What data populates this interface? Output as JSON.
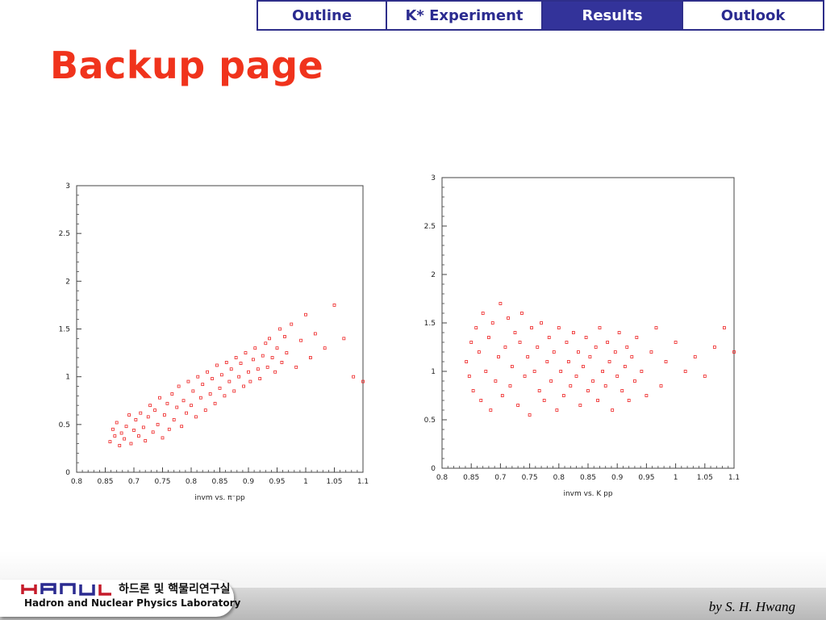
{
  "nav": {
    "tabs": [
      {
        "label": "Outline",
        "active": false
      },
      {
        "label": "K* Experiment",
        "active": false
      },
      {
        "label": "Results",
        "active": true
      },
      {
        "label": "Outlook",
        "active": false
      }
    ]
  },
  "title": "Backup page",
  "colors": {
    "title": "#f0331c",
    "nav_border": "#2e2e8a",
    "nav_active_bg": "#33339a",
    "nav_text": "#2b2b90",
    "marker": "#ee2222"
  },
  "chart_data": [
    {
      "type": "scatter",
      "title": "",
      "xlabel": "invm vs. π⁻pp",
      "ylabel": "",
      "xlim": [
        0.8,
        1.1
      ],
      "ylim": [
        0,
        3
      ],
      "xticks": [
        "0.8",
        "0.85",
        "0.7",
        "0.75",
        "0.8",
        "0.85",
        "0.9",
        "0.95",
        "1",
        "1.05",
        "1.1"
      ],
      "yticks": [
        "0",
        "0.5",
        "1",
        "1.5",
        "2",
        "2.5",
        "3"
      ],
      "grid": false,
      "marker": "open-square",
      "points": [
        [
          0.835,
          0.32
        ],
        [
          0.838,
          0.45
        ],
        [
          0.84,
          0.38
        ],
        [
          0.842,
          0.52
        ],
        [
          0.845,
          0.28
        ],
        [
          0.847,
          0.41
        ],
        [
          0.85,
          0.35
        ],
        [
          0.852,
          0.48
        ],
        [
          0.855,
          0.6
        ],
        [
          0.857,
          0.3
        ],
        [
          0.86,
          0.44
        ],
        [
          0.862,
          0.55
        ],
        [
          0.865,
          0.38
        ],
        [
          0.867,
          0.62
        ],
        [
          0.87,
          0.47
        ],
        [
          0.872,
          0.33
        ],
        [
          0.875,
          0.58
        ],
        [
          0.877,
          0.7
        ],
        [
          0.88,
          0.42
        ],
        [
          0.882,
          0.65
        ],
        [
          0.885,
          0.5
        ],
        [
          0.887,
          0.78
        ],
        [
          0.89,
          0.36
        ],
        [
          0.892,
          0.6
        ],
        [
          0.895,
          0.72
        ],
        [
          0.897,
          0.45
        ],
        [
          0.9,
          0.82
        ],
        [
          0.902,
          0.55
        ],
        [
          0.905,
          0.68
        ],
        [
          0.907,
          0.9
        ],
        [
          0.91,
          0.48
        ],
        [
          0.912,
          0.75
        ],
        [
          0.915,
          0.62
        ],
        [
          0.917,
          0.95
        ],
        [
          0.92,
          0.7
        ],
        [
          0.922,
          0.85
        ],
        [
          0.925,
          0.58
        ],
        [
          0.927,
          1.0
        ],
        [
          0.93,
          0.78
        ],
        [
          0.932,
          0.92
        ],
        [
          0.935,
          0.65
        ],
        [
          0.937,
          1.05
        ],
        [
          0.94,
          0.82
        ],
        [
          0.942,
          0.98
        ],
        [
          0.945,
          0.72
        ],
        [
          0.947,
          1.12
        ],
        [
          0.95,
          0.88
        ],
        [
          0.952,
          1.02
        ],
        [
          0.955,
          0.8
        ],
        [
          0.957,
          1.15
        ],
        [
          0.96,
          0.95
        ],
        [
          0.962,
          1.08
        ],
        [
          0.965,
          0.85
        ],
        [
          0.967,
          1.2
        ],
        [
          0.97,
          1.0
        ],
        [
          0.972,
          1.14
        ],
        [
          0.975,
          0.9
        ],
        [
          0.977,
          1.25
        ],
        [
          0.98,
          1.05
        ],
        [
          0.982,
          0.95
        ],
        [
          0.985,
          1.18
        ],
        [
          0.987,
          1.3
        ],
        [
          0.99,
          1.08
        ],
        [
          0.992,
          0.98
        ],
        [
          0.995,
          1.22
        ],
        [
          0.998,
          1.35
        ],
        [
          1.0,
          1.1
        ],
        [
          1.002,
          1.4
        ],
        [
          1.005,
          1.2
        ],
        [
          1.008,
          1.05
        ],
        [
          1.01,
          1.3
        ],
        [
          1.013,
          1.5
        ],
        [
          1.015,
          1.15
        ],
        [
          1.018,
          1.42
        ],
        [
          1.02,
          1.25
        ],
        [
          1.025,
          1.55
        ],
        [
          1.03,
          1.1
        ],
        [
          1.035,
          1.38
        ],
        [
          1.04,
          1.65
        ],
        [
          1.045,
          1.2
        ],
        [
          1.05,
          1.45
        ],
        [
          1.06,
          1.3
        ],
        [
          1.07,
          1.75
        ],
        [
          1.08,
          1.4
        ],
        [
          1.09,
          1.0
        ],
        [
          1.1,
          0.95
        ]
      ]
    },
    {
      "type": "scatter",
      "title": "",
      "xlabel": "invm vs. K pp",
      "ylabel": "",
      "xlim": [
        0.8,
        1.1
      ],
      "ylim": [
        0,
        3
      ],
      "xticks": [
        "0.8",
        "0.85",
        "0.7",
        "0.75",
        "0.8",
        "0.85",
        "0.9",
        "0.95",
        "1",
        "1.05",
        "1.1"
      ],
      "yticks": [
        "0",
        "0.5",
        "1",
        "1.5",
        "2",
        "2.5",
        "3"
      ],
      "grid": false,
      "marker": "open-square",
      "points": [
        [
          0.825,
          1.1
        ],
        [
          0.828,
          0.95
        ],
        [
          0.83,
          1.3
        ],
        [
          0.832,
          0.8
        ],
        [
          0.835,
          1.45
        ],
        [
          0.838,
          1.2
        ],
        [
          0.84,
          0.7
        ],
        [
          0.842,
          1.6
        ],
        [
          0.845,
          1.0
        ],
        [
          0.848,
          1.35
        ],
        [
          0.85,
          0.6
        ],
        [
          0.852,
          1.5
        ],
        [
          0.855,
          0.9
        ],
        [
          0.858,
          1.15
        ],
        [
          0.86,
          1.7
        ],
        [
          0.862,
          0.75
        ],
        [
          0.865,
          1.25
        ],
        [
          0.868,
          1.55
        ],
        [
          0.87,
          0.85
        ],
        [
          0.872,
          1.05
        ],
        [
          0.875,
          1.4
        ],
        [
          0.878,
          0.65
        ],
        [
          0.88,
          1.3
        ],
        [
          0.882,
          1.6
        ],
        [
          0.885,
          0.95
        ],
        [
          0.888,
          1.15
        ],
        [
          0.89,
          0.55
        ],
        [
          0.892,
          1.45
        ],
        [
          0.895,
          1.0
        ],
        [
          0.898,
          1.25
        ],
        [
          0.9,
          0.8
        ],
        [
          0.902,
          1.5
        ],
        [
          0.905,
          0.7
        ],
        [
          0.908,
          1.1
        ],
        [
          0.91,
          1.35
        ],
        [
          0.912,
          0.9
        ],
        [
          0.915,
          1.2
        ],
        [
          0.918,
          0.6
        ],
        [
          0.92,
          1.45
        ],
        [
          0.922,
          1.0
        ],
        [
          0.925,
          0.75
        ],
        [
          0.928,
          1.3
        ],
        [
          0.93,
          1.1
        ],
        [
          0.932,
          0.85
        ],
        [
          0.935,
          1.4
        ],
        [
          0.938,
          0.95
        ],
        [
          0.94,
          1.2
        ],
        [
          0.942,
          0.65
        ],
        [
          0.945,
          1.05
        ],
        [
          0.948,
          1.35
        ],
        [
          0.95,
          0.8
        ],
        [
          0.952,
          1.15
        ],
        [
          0.955,
          0.9
        ],
        [
          0.958,
          1.25
        ],
        [
          0.96,
          0.7
        ],
        [
          0.962,
          1.45
        ],
        [
          0.965,
          1.0
        ],
        [
          0.968,
          0.85
        ],
        [
          0.97,
          1.3
        ],
        [
          0.972,
          1.1
        ],
        [
          0.975,
          0.6
        ],
        [
          0.978,
          1.2
        ],
        [
          0.98,
          0.95
        ],
        [
          0.982,
          1.4
        ],
        [
          0.985,
          0.8
        ],
        [
          0.988,
          1.05
        ],
        [
          0.99,
          1.25
        ],
        [
          0.992,
          0.7
        ],
        [
          0.995,
          1.15
        ],
        [
          0.998,
          0.9
        ],
        [
          1.0,
          1.35
        ],
        [
          1.005,
          1.0
        ],
        [
          1.01,
          0.75
        ],
        [
          1.015,
          1.2
        ],
        [
          1.02,
          1.45
        ],
        [
          1.025,
          0.85
        ],
        [
          1.03,
          1.1
        ],
        [
          1.04,
          1.3
        ],
        [
          1.05,
          1.0
        ],
        [
          1.06,
          1.15
        ],
        [
          1.07,
          0.95
        ],
        [
          1.08,
          1.25
        ],
        [
          1.09,
          1.45
        ],
        [
          1.1,
          1.2
        ]
      ]
    }
  ],
  "footer": {
    "logo_text": "HANUL",
    "lab_korean": "하드론 및 핵물리연구실",
    "lab_name": "Hadron and Nuclear Physics Laboratory",
    "author": "by S. H. Hwang"
  }
}
